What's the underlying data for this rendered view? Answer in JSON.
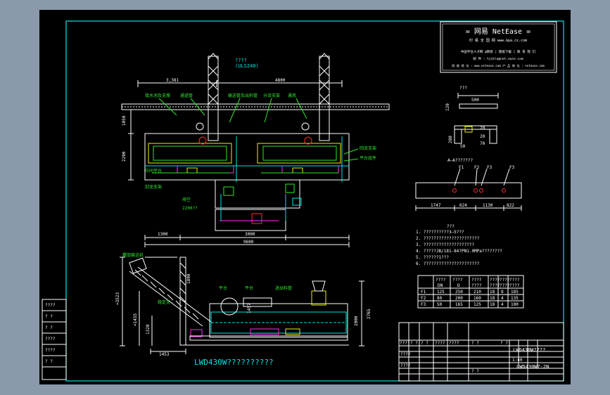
{
  "stamp": {
    "brand": "=  网易 NetEase  =",
    "line1": "印 易 全 国 网    www.Gpa.cx.com",
    "line2": "中国平台人才网 @网易 | 图纸下载 | 联 系 我 们",
    "line3": "邮 件 : hjskla@net.ease.com",
    "line4": "网 络 地 址 : www.netease.com  产 品 地 址 : netease.com"
  },
  "plan": {
    "label_top1": "????",
    "label_top2": "(ULS240)",
    "dim_3381": "3,381",
    "dim_4800": "4800",
    "dim_1050": "1050",
    "dim_2200": "2200",
    "dim_1300": "1300",
    "dim_3000": "3000",
    "dim_9600": "9600",
    "callouts": [
      "接水池及支撑",
      "通道管",
      "输送管及出料管",
      "分流支架",
      "通风",
      "中间平台",
      "刮泥支架",
      "回流支架",
      "平台组件",
      "排空",
      "2200??"
    ]
  },
  "elev": {
    "labels": [
      "螺旋输送机",
      "1800",
      "平台",
      "平台",
      "输送机",
      "进出料管",
      "稳定支"
    ],
    "dim_left1": "≈3523",
    "dim_left2": "≈1455",
    "dim_left3": "1320",
    "dim_right1": "2765",
    "dim_right2": "2000",
    "dim_mid": "1457",
    "dim_bottom": "1453",
    "title": "LWD430W??????????"
  },
  "detail": {
    "title": "???",
    "dim_500": "500",
    "dim_120": "120",
    "dim_280": "280",
    "dim_50": "50",
    "dim_20a": "20",
    "dim_20b": "20",
    "dim_70": "70",
    "section_title": "A—A???????",
    "flanges": [
      "F1",
      "F2",
      "F3",
      "F3"
    ],
    "bottom_dims": [
      "1747",
      "624",
      "1130",
      "822"
    ]
  },
  "notes": {
    "title": "???",
    "items": [
      "1. ??????????3—5???",
      "2. ??????????????????????",
      "3. ????????????????????",
      "4. ?????JB/181-84?PN1.0MPa????????",
      "5. ??????1???",
      "6. ??????????????????????"
    ]
  },
  "table": {
    "headers": [
      "????",
      "????",
      "????",
      "????",
      "????",
      "????",
      "????"
    ],
    "subheaders": [
      "",
      "DN",
      "D",
      "????",
      "????",
      "????",
      "????"
    ],
    "rows": [
      [
        "F1",
        "125",
        "250",
        "210",
        "18",
        "8",
        "185"
      ],
      [
        "F2",
        "80",
        "200",
        "160",
        "18",
        "4",
        "135"
      ],
      [
        "F3",
        "50",
        "165",
        "125",
        "18",
        "4",
        "100"
      ]
    ]
  },
  "leftstrip": [
    "????",
    "? ?",
    "? ?",
    "????",
    "????",
    "? ?"
  ],
  "titleblock": {
    "drawing_name": "LWD430W????",
    "drawing_no": "LWD430W?-2N",
    "scale": "1:40",
    "cells": [
      "????",
      "? ?",
      "? ?",
      "????",
      "????",
      "????",
      "????",
      "? ?",
      "? ?",
      "? ?"
    ]
  },
  "colors": {
    "frame": "#00e5e5",
    "green": "#2ee82e",
    "yellow": "#f0f000",
    "magenta": "#ff2bff",
    "red": "#ff3030",
    "white": "#ffffff"
  }
}
